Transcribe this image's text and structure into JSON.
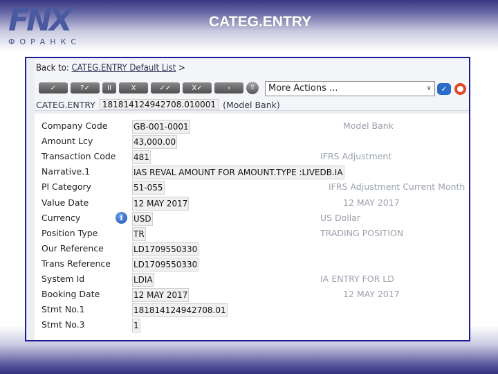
{
  "header": {
    "logo_text": "FNX",
    "logo_subtitle": "ФОРАНКС",
    "title": "CATEG.ENTRY"
  },
  "nav": {
    "back_prefix": "Back to:",
    "back_link": "CATEG.ENTRY Default List",
    "back_suffix": ">"
  },
  "toolbar": {
    "buttons": [
      "✓",
      "?✓",
      "II",
      "X",
      "✓✓",
      "X✓",
      "›"
    ],
    "more_actions": "More Actions ..."
  },
  "record": {
    "app": "CATEG.ENTRY",
    "id": "181814124942708.010001",
    "company": "(Model Bank)"
  },
  "fields": [
    {
      "label": "Company Code",
      "value": "GB-001-0001",
      "desc": "Model Bank"
    },
    {
      "label": "Amount Lcy",
      "value": "43,000.00",
      "desc": ""
    },
    {
      "label": "Transaction Code",
      "value": "481",
      "desc": "IFRS Adjustment"
    },
    {
      "label": "Narrative.1",
      "value": "IAS REVAL AMOUNT FOR AMOUNT.TYPE :LIVEDB.IA",
      "desc": ""
    },
    {
      "label": "Pl Category",
      "value": "51-055",
      "desc": "IFRS Adjustment Current Month"
    },
    {
      "label": "Value Date",
      "value": "12 MAY 2017",
      "desc": "12 MAY 2017"
    },
    {
      "label": "Currency",
      "value": "USD",
      "desc": "US Dollar"
    },
    {
      "label": "Position Type",
      "value": "TR",
      "desc": "TRADING POSITION"
    },
    {
      "label": "Our Reference",
      "value": "LD1709550330",
      "desc": ""
    },
    {
      "label": "Trans Reference",
      "value": "LD1709550330",
      "desc": ""
    },
    {
      "label": "System Id",
      "value": "LDIA",
      "desc": "IA ENTRY FOR LD"
    },
    {
      "label": "Booking Date",
      "value": "12 MAY 2017",
      "desc": "12 MAY 2017"
    },
    {
      "label": "Stmt No.1",
      "value": "181814124942708.01",
      "desc": ""
    },
    {
      "label": "Stmt No.3",
      "value": "1",
      "desc": ""
    }
  ]
}
